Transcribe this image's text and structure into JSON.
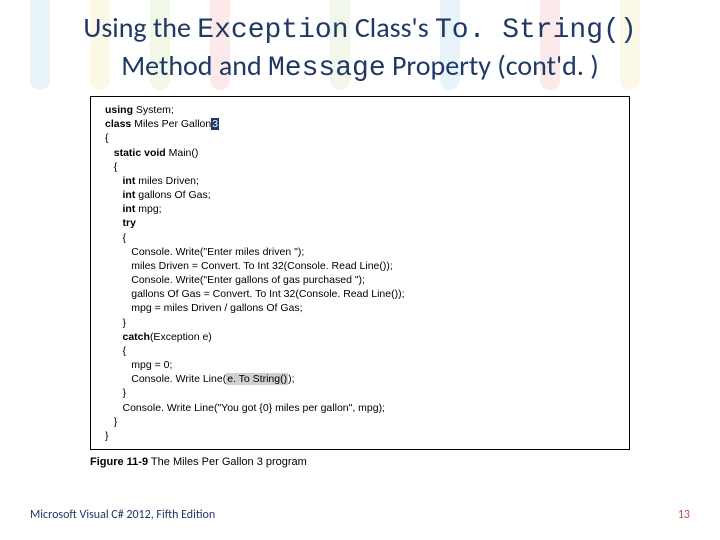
{
  "title": {
    "part1": "Using the ",
    "mono1": "Exception",
    "part2": " Class's ",
    "mono2": "To. String()",
    "part3": " Method and ",
    "mono3": "Message",
    "part4": " Property (cont'd. )"
  },
  "code": {
    "l01a": "using",
    "l01b": " System;",
    "l02a": "class",
    "l02b": " Miles Per Gallon",
    "l02c": "3",
    "l03": "{",
    "l04a": "   static void",
    "l04b": " Main()",
    "l05": "   {",
    "l06a": "      int",
    "l06b": " miles Driven;",
    "l07a": "      int",
    "l07b": " gallons Of Gas;",
    "l08a": "      int",
    "l08b": " mpg;",
    "l09a": "      try",
    "l10": "      {",
    "l11": "         Console. Write(\"Enter miles driven \");",
    "l12": "         miles Driven = Convert. To Int 32(Console. Read Line());",
    "l13": "         Console. Write(\"Enter gallons of gas purchased \");",
    "l14": "         gallons Of Gas = Convert. To Int 32(Console. Read Line());",
    "l15": "         mpg = miles Driven / gallons Of Gas;",
    "l16": "      }",
    "l17a": "      catch",
    "l17b": "(Exception e)",
    "l18": "      {",
    "l19": "         mpg = 0;",
    "l20a": "         Console. Write Line(",
    "l20b": "e. To String()",
    "l20c": ");",
    "l21": "      }",
    "l22": "      Console. Write Line(\"You got {0} miles per gallon\", mpg);",
    "l23": "   }",
    "l24": "}"
  },
  "caption": {
    "label": "Figure 11-9",
    "text": "   The Miles Per Gallon 3 program"
  },
  "footer": {
    "left": "Microsoft Visual C# 2012, Fifth Edition",
    "right": "13"
  }
}
